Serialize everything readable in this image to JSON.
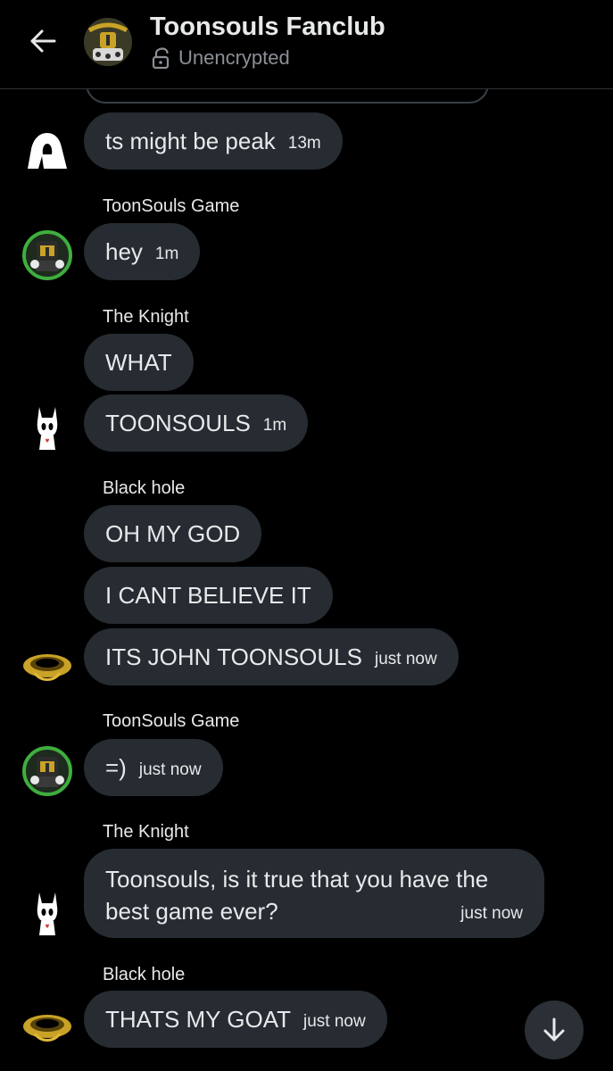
{
  "header": {
    "title": "Toonsouls Fanclub",
    "encryption": "Unencrypted"
  },
  "messages": [
    {
      "sender": "",
      "text": "ts might be peak",
      "time": "13m"
    },
    {
      "sender": "ToonSouls Game",
      "text": "hey",
      "time": "1m"
    },
    {
      "sender": "The Knight",
      "text": "WHAT",
      "time": ""
    },
    {
      "sender": "",
      "text": "TOONSOULS",
      "time": "1m"
    },
    {
      "sender": "Black hole",
      "text": "OH MY GOD",
      "time": ""
    },
    {
      "sender": "",
      "text": "I CANT BELIEVE IT",
      "time": ""
    },
    {
      "sender": "",
      "text": "ITS JOHN TOONSOULS",
      "time": "just now"
    },
    {
      "sender": "ToonSouls Game",
      "text": "=)",
      "time": "just now"
    },
    {
      "sender": "The Knight",
      "text": "Toonsouls, is it true that you have the best game ever?",
      "time": "just now"
    },
    {
      "sender": "Black hole",
      "text": "THATS MY GOAT",
      "time": "just now"
    }
  ],
  "icons": {
    "back": "arrow-left-icon",
    "lock": "unlocked-padlock-icon",
    "scroll": "arrow-down-icon"
  },
  "colors": {
    "background": "#000000",
    "bubble": "#262c31",
    "text": "#e7e9ea",
    "muted": "#8b9096",
    "toonsouls_ring": "#3fae3f",
    "black_hole_gold": "#c9a227"
  }
}
